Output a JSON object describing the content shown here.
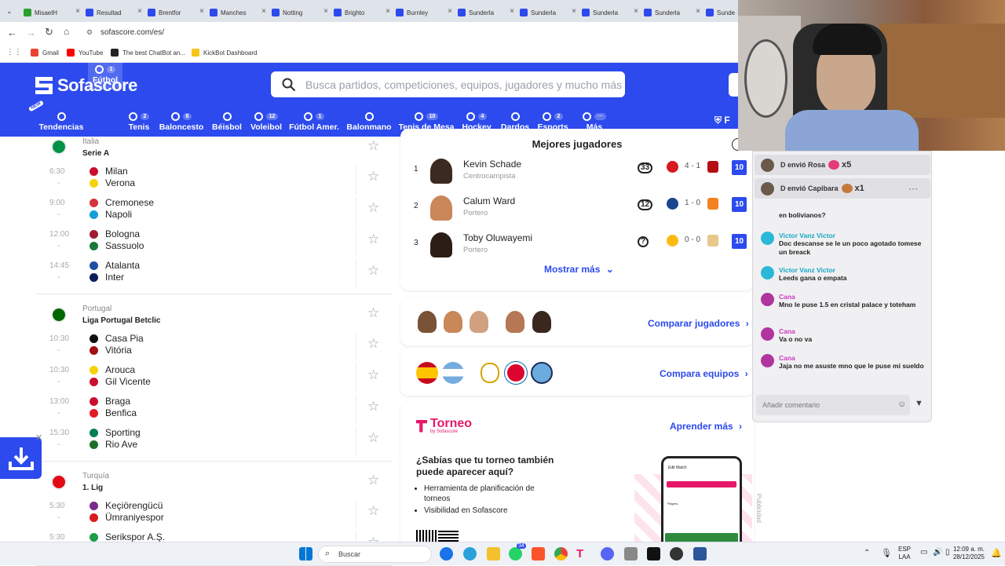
{
  "browser": {
    "tabs": [
      {
        "label": "MisaelH",
        "color": "#2ca02c"
      },
      {
        "label": "Resultad",
        "color": "#2c4aed"
      },
      {
        "label": "Brentfor",
        "color": "#2c4aed"
      },
      {
        "label": "Manches",
        "color": "#2c4aed"
      },
      {
        "label": "Notting",
        "color": "#2c4aed"
      },
      {
        "label": "Brighto",
        "color": "#2c4aed"
      },
      {
        "label": "Burnley",
        "color": "#2c4aed"
      },
      {
        "label": "Sunderla",
        "color": "#2c4aed"
      },
      {
        "label": "Sunderla",
        "color": "#2c4aed"
      },
      {
        "label": "Sunderla",
        "color": "#2c4aed"
      },
      {
        "label": "Sunderla",
        "color": "#2c4aed"
      },
      {
        "label": "Sunde",
        "color": "#2c4aed"
      }
    ],
    "url": "sofascore.com/es/",
    "bookmarks": [
      {
        "label": "Gmail",
        "color": "#ea4335"
      },
      {
        "label": "YouTube",
        "color": "#ff0000"
      },
      {
        "label": "The best ChatBot an...",
        "color": "#222222"
      },
      {
        "label": "KickBot Dashboard",
        "color": "#f5c518"
      }
    ]
  },
  "header": {
    "logo": "Sofascore",
    "search_placeholder": "Busca partidos, competiciones, equipos, jugadores y mucho más",
    "right_label": "F",
    "sports": [
      {
        "label": "Tendencias",
        "count": "",
        "badge": "NEW"
      },
      {
        "label": "Fútbol",
        "count": "1"
      },
      {
        "label": "Tenis",
        "count": "2"
      },
      {
        "label": "Baloncesto",
        "count": "8"
      },
      {
        "label": "Béisbol",
        "count": ""
      },
      {
        "label": "Voleibol",
        "count": "12"
      },
      {
        "label": "Fútbol Amer.",
        "count": "1"
      },
      {
        "label": "Balonmano",
        "count": ""
      },
      {
        "label": "Tenis de Mesa",
        "count": "10"
      },
      {
        "label": "Hockey",
        "count": "4"
      },
      {
        "label": "Dardos",
        "count": ""
      },
      {
        "label": "Esports",
        "count": "2"
      },
      {
        "label": "Más",
        "count": "···"
      }
    ]
  },
  "leagues": [
    {
      "country": "Italia",
      "competition": "Serie A",
      "matches": [
        {
          "time": "6:30",
          "home": "Milan",
          "away": "Verona"
        },
        {
          "time": "9:00",
          "home": "Cremonese",
          "away": "Napoli"
        },
        {
          "time": "12:00",
          "home": "Bologna",
          "away": "Sassuolo"
        },
        {
          "time": "14:45",
          "home": "Atalanta",
          "away": "Inter"
        }
      ]
    },
    {
      "country": "Portugal",
      "competition": "Liga Portugal Betclic",
      "matches": [
        {
          "time": "10:30",
          "home": "Casa Pia",
          "away": "Vitória"
        },
        {
          "time": "10:30",
          "home": "Arouca",
          "away": "Gil Vicente"
        },
        {
          "time": "13:00",
          "home": "Braga",
          "away": "Benfica"
        },
        {
          "time": "15:30",
          "home": "Sporting",
          "away": "Rio Ave"
        }
      ]
    },
    {
      "country": "Turquía",
      "competition": "1. Lig",
      "matches": [
        {
          "time": "5:30",
          "home": "Keçiörengücü",
          "away": "Ümraniyespor"
        },
        {
          "time": "5:30",
          "home": "Serikspor A.Ş.",
          "away": "Bodrumspor"
        }
      ]
    }
  ],
  "top_players": {
    "title": "Mejores jugadores",
    "players": [
      {
        "rank": "1",
        "name": "Kevin Schade",
        "role": "Centrocampista",
        "shirt": "33",
        "score": "4 - 1",
        "rating": "10"
      },
      {
        "rank": "2",
        "name": "Calum Ward",
        "role": "Portero",
        "shirt": "12",
        "score": "1 - 0",
        "rating": "10"
      },
      {
        "rank": "3",
        "name": "Toby Oluwayemi",
        "role": "Portero",
        "shirt": "?",
        "score": "0 - 0",
        "rating": "10"
      }
    ],
    "more": "Mostrar más"
  },
  "compare_players": "Comparar jugadores",
  "compare_teams": "Compara equipos",
  "torneo": {
    "brand": "Torneo",
    "brand_sub": "by Sofascore",
    "learn": "Aprender más",
    "question": "¿Sabías que tu torneo también puede aparecer aquí?",
    "bullets": [
      "Herramienta de planificación de torneos",
      "Visibilidad en Sofascore"
    ],
    "phone_title": "Edit Match",
    "phone_players": "Players"
  },
  "ad_label": "Publicidad",
  "chat": {
    "gifts": [
      {
        "text": "D envió Rosa",
        "mult": "x5"
      },
      {
        "text": "D envió Capibara",
        "mult": "x1"
      }
    ],
    "messages": [
      {
        "user": "",
        "text": "en bolivianos?",
        "pink": false
      },
      {
        "user": "Victor Vanz Victor",
        "text": "Doc descanse se le un poco agotado tomese un breack",
        "pink": false
      },
      {
        "user": "Victor Vanz Victor",
        "text": "Leeds gana o empata",
        "pink": false
      },
      {
        "user": "Cana",
        "text": "Mno le puse 1.5 en cristal palace y toteham",
        "pink": true
      },
      {
        "user": "Cana",
        "text": "Va o no va",
        "pink": true
      },
      {
        "user": "Cana",
        "text": "Jaja no me asuste mno que le puse mi sueldo",
        "pink": true
      }
    ],
    "input_placeholder": "Añadir comentario"
  },
  "taskbar": {
    "search": "Buscar",
    "lang": "ESP",
    "lang2": "LAA",
    "time": "12:09 a. m.",
    "date": "28/12/2025",
    "badge": "34"
  }
}
